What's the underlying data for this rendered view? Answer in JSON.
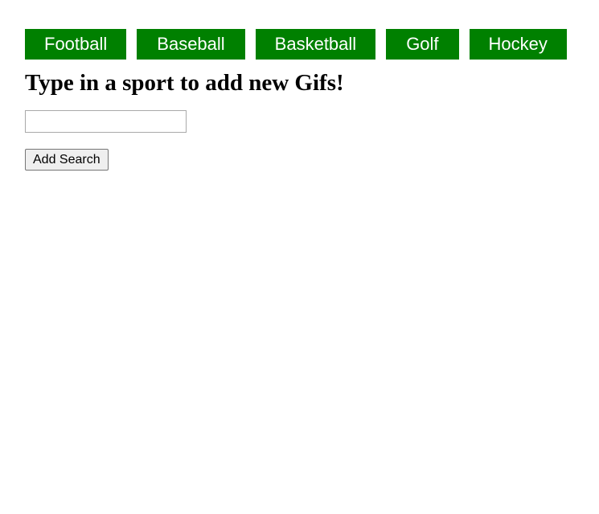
{
  "sports": [
    {
      "label": "Football"
    },
    {
      "label": "Baseball"
    },
    {
      "label": "Basketball"
    },
    {
      "label": "Golf"
    },
    {
      "label": "Hockey"
    }
  ],
  "title": "Type in a sport to add new Gifs!",
  "search": {
    "value": "",
    "placeholder": "",
    "button_label": "Add Search"
  },
  "colors": {
    "sport_button_bg": "#008000",
    "sport_button_text": "#ffffff"
  }
}
